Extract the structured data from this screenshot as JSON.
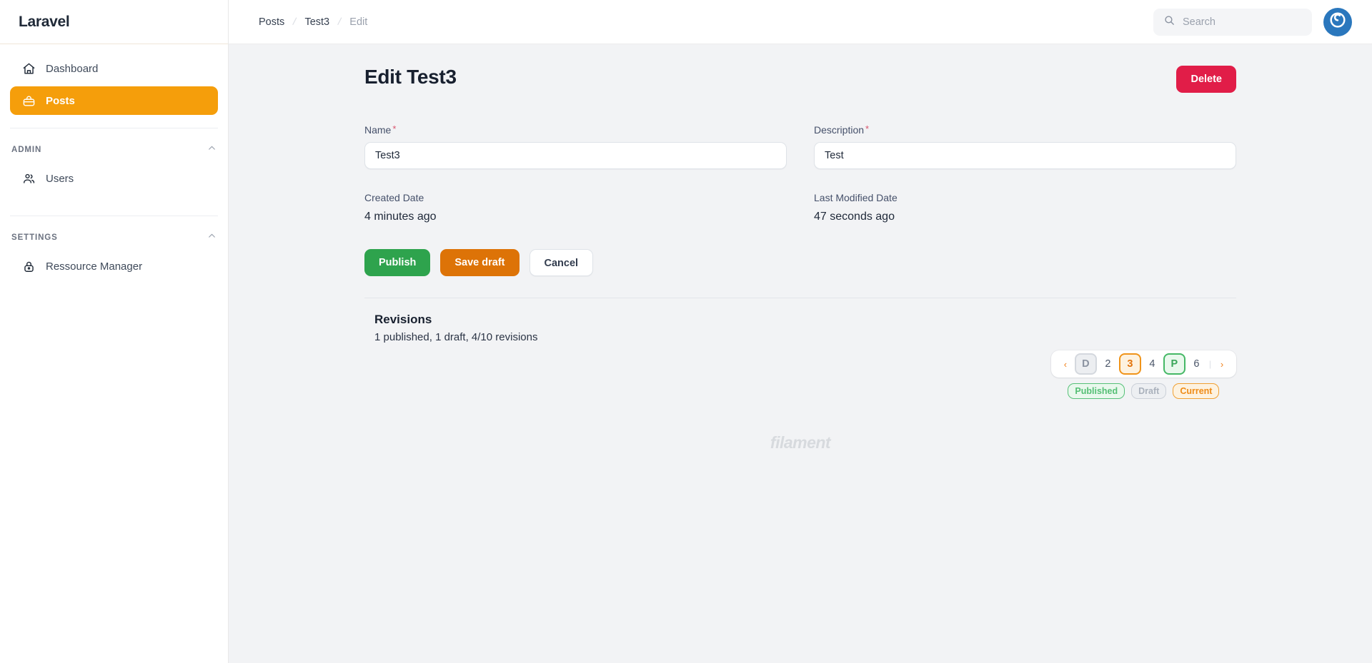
{
  "brand": {
    "name": "Laravel"
  },
  "sidebar": {
    "items": [
      {
        "label": "Dashboard",
        "icon": "home-icon",
        "active": false
      },
      {
        "label": "Posts",
        "icon": "briefcase-icon",
        "active": true
      }
    ],
    "groups": [
      {
        "title": "ADMIN",
        "collapse_icon": "chevron-up-icon",
        "items": [
          {
            "label": "Users",
            "icon": "users-icon"
          }
        ]
      },
      {
        "title": "SETTINGS",
        "collapse_icon": "chevron-up-icon",
        "items": [
          {
            "label": "Ressource Manager",
            "icon": "lock-icon"
          }
        ]
      }
    ]
  },
  "topbar": {
    "breadcrumbs": [
      {
        "label": "Posts",
        "current": false
      },
      {
        "label": "Test3",
        "current": false
      },
      {
        "label": "Edit",
        "current": true
      }
    ],
    "separator": "/",
    "search": {
      "placeholder": "Search",
      "icon": "search-icon",
      "value": ""
    },
    "avatar": {
      "icon": "user-avatar-icon"
    }
  },
  "page": {
    "title": "Edit Test3",
    "delete_label": "Delete",
    "fields": {
      "name": {
        "label": "Name",
        "required_marker": "*",
        "value": "Test3"
      },
      "description": {
        "label": "Description",
        "required_marker": "*",
        "value": "Test"
      }
    },
    "meta": {
      "created": {
        "label": "Created Date",
        "value": "4 minutes ago"
      },
      "modified": {
        "label": "Last Modified Date",
        "value": "47 seconds ago"
      }
    },
    "actions": {
      "publish": "Publish",
      "save_draft": "Save draft",
      "cancel": "Cancel"
    },
    "revisions": {
      "title": "Revisions",
      "summary": "1 published, 1 draft, 4/10 revisions",
      "pager": {
        "prev": "‹",
        "next": "›",
        "ellipsis": "|",
        "pages": [
          {
            "label": "D",
            "state": "draft"
          },
          {
            "label": "2",
            "state": "normal"
          },
          {
            "label": "3",
            "state": "current"
          },
          {
            "label": "4",
            "state": "normal"
          },
          {
            "label": "P",
            "state": "published"
          },
          {
            "label": "6",
            "state": "normal"
          }
        ]
      },
      "legend": [
        {
          "label": "Published",
          "state": "published"
        },
        {
          "label": "Draft",
          "state": "draft"
        },
        {
          "label": "Current",
          "state": "current"
        }
      ]
    }
  },
  "watermark": {
    "text": "filament"
  },
  "colors": {
    "brand_orange": "#f59e0b",
    "publish_green": "#2ea34d",
    "draft_orange": "#dd7307",
    "delete_red": "#e11d48",
    "avatar_blue": "#2a77bd"
  }
}
